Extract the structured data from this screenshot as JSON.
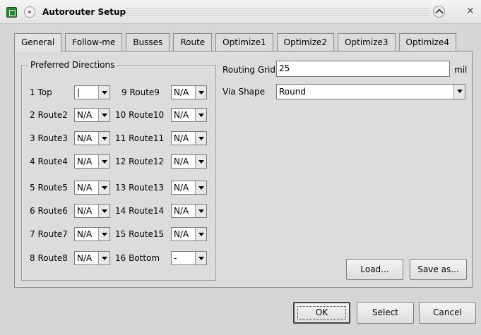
{
  "window": {
    "title": "Autorouter Setup"
  },
  "tabs": [
    "General",
    "Follow-me",
    "Busses",
    "Route",
    "Optimize1",
    "Optimize2",
    "Optimize3",
    "Optimize4"
  ],
  "preferred_directions": {
    "title": "Preferred Directions",
    "left": [
      {
        "label": "1 Top",
        "value": "|"
      },
      {
        "label": "2 Route2",
        "value": "N/A"
      },
      {
        "label": "3 Route3",
        "value": "N/A"
      },
      {
        "label": "4 Route4",
        "value": "N/A"
      },
      {
        "label": "5 Route5",
        "value": "N/A"
      },
      {
        "label": "6 Route6",
        "value": "N/A"
      },
      {
        "label": "7 Route7",
        "value": "N/A"
      },
      {
        "label": "8 Route8",
        "value": "N/A"
      }
    ],
    "right": [
      {
        "label": "9 Route9",
        "value": "N/A"
      },
      {
        "label": "10 Route10",
        "value": "N/A"
      },
      {
        "label": "11 Route11",
        "value": "N/A"
      },
      {
        "label": "12 Route12",
        "value": "N/A"
      },
      {
        "label": "13 Route13",
        "value": "N/A"
      },
      {
        "label": "14 Route14",
        "value": "N/A"
      },
      {
        "label": "15 Route15",
        "value": "N/A"
      },
      {
        "label": "16 Bottom",
        "value": "-"
      }
    ]
  },
  "routing_grid": {
    "label": "Routing Grid",
    "value": "25",
    "unit": "mil"
  },
  "via_shape": {
    "label": "Via Shape",
    "value": "Round"
  },
  "buttons": {
    "load": "Load...",
    "save_as": "Save as...",
    "ok": "OK",
    "select": "Select",
    "cancel": "Cancel"
  }
}
